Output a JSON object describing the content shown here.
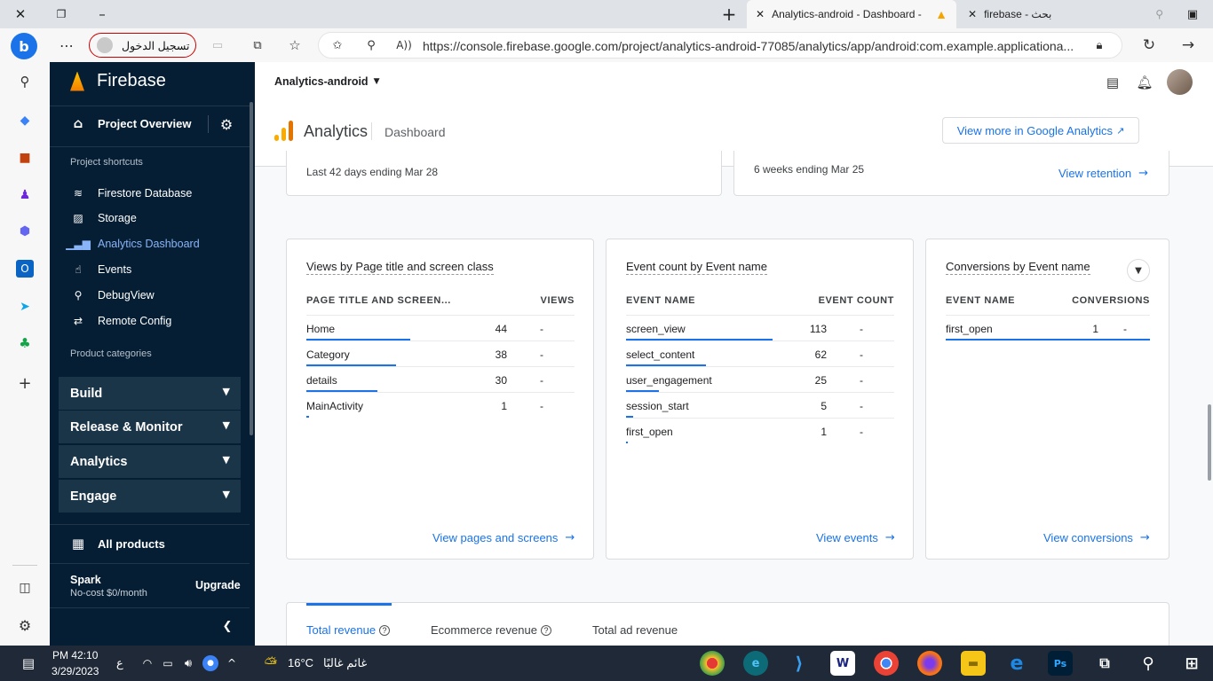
{
  "browser": {
    "tabs": [
      {
        "title": "Analytics-android - Dashboard -",
        "active": true
      },
      {
        "title": "firebase - بحث",
        "active": false
      }
    ],
    "url": "https://console.firebase.google.com/project/analytics-android-77085/analytics/app/android:com.example.applicationa...",
    "login_label": "تسجيل الدخول"
  },
  "sidebar": {
    "brand": "Firebase",
    "project_overview": "Project Overview",
    "shortcuts_heading": "Project shortcuts",
    "shortcuts": [
      {
        "label": "Firestore Database",
        "icon": "firestore-icon"
      },
      {
        "label": "Storage",
        "icon": "storage-icon"
      },
      {
        "label": "Analytics Dashboard",
        "icon": "analytics-icon",
        "active": true
      },
      {
        "label": "Events",
        "icon": "events-icon"
      },
      {
        "label": "DebugView",
        "icon": "debugview-icon"
      },
      {
        "label": "Remote Config",
        "icon": "remote-config-icon"
      }
    ],
    "categories_heading": "Product categories",
    "categories": [
      "Build",
      "Release & Monitor",
      "Analytics",
      "Engage"
    ],
    "all_products": "All products",
    "plan_name": "Spark",
    "plan_desc": "No-cost $0/month",
    "upgrade": "Upgrade"
  },
  "header": {
    "project": "Analytics-android",
    "product": "Analytics",
    "page": "Dashboard",
    "view_more": "View more in Google Analytics"
  },
  "top_cards": {
    "left_subtitle": "Last 42 days ending Mar 28",
    "right_subtitle": "6 weeks ending Mar 25",
    "right_link": "View retention"
  },
  "views_card": {
    "title": "Views by Page title and screen class",
    "col1": "PAGE TITLE AND SCREEN...",
    "col2": "VIEWS",
    "rows": [
      {
        "label": "Home",
        "value": "44",
        "extra": "-"
      },
      {
        "label": "Category",
        "value": "38",
        "extra": "-"
      },
      {
        "label": "details",
        "value": "30",
        "extra": "-"
      },
      {
        "label": "MainActivity",
        "value": "1",
        "extra": "-"
      }
    ],
    "link": "View pages and screens"
  },
  "events_card": {
    "title": "Event count by Event name",
    "col1": "EVENT NAME",
    "col2": "EVENT COUNT",
    "rows": [
      {
        "label": "screen_view",
        "value": "113",
        "extra": "-"
      },
      {
        "label": "select_content",
        "value": "62",
        "extra": "-"
      },
      {
        "label": "user_engagement",
        "value": "25",
        "extra": "-"
      },
      {
        "label": "session_start",
        "value": "5",
        "extra": "-"
      },
      {
        "label": "first_open",
        "value": "1",
        "extra": "-"
      }
    ],
    "link": "View events"
  },
  "conversions_card": {
    "title": "Conversions by Event name",
    "col1": "EVENT NAME",
    "col2": "CONVERSIONS",
    "rows": [
      {
        "label": "first_open",
        "value": "1",
        "extra": "-"
      }
    ],
    "link": "View conversions"
  },
  "revenue": {
    "tabs": [
      "Total revenue",
      "Ecommerce revenue",
      "Total ad revenue"
    ]
  },
  "taskbar": {
    "time": "PM 42:10",
    "date": "3/29/2023",
    "weather_temp": "16°C",
    "weather_desc": "غائم غالبًا",
    "lang": "ع"
  },
  "colors": {
    "accent": "#1a73e8",
    "sidebar": "#051e34",
    "active_nav": "#8ab4f8"
  }
}
